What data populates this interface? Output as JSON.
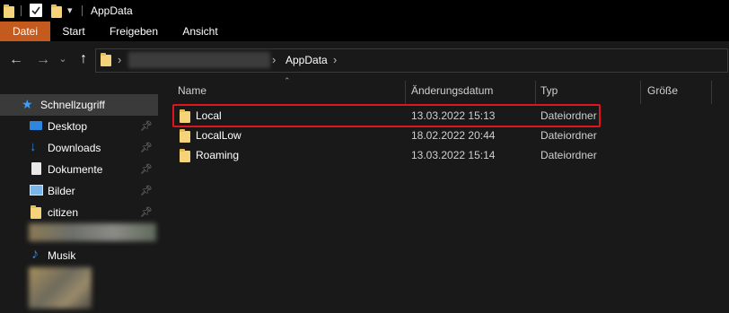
{
  "window": {
    "title": "AppData"
  },
  "ribbon": {
    "tabs": [
      "Datei",
      "Start",
      "Freigeben",
      "Ansicht"
    ]
  },
  "address": {
    "current": "AppData",
    "separator": "›"
  },
  "nav": {
    "back": "←",
    "forward": "→",
    "recent": "⌄",
    "up": "↑"
  },
  "sidebar": {
    "items": [
      {
        "label": "Schnellzugriff",
        "icon": "star-icon"
      },
      {
        "label": "Desktop",
        "icon": "desktop-icon"
      },
      {
        "label": "Downloads",
        "icon": "download-icon"
      },
      {
        "label": "Dokumente",
        "icon": "document-icon"
      },
      {
        "label": "Bilder",
        "icon": "pictures-icon"
      },
      {
        "label": "citizen",
        "icon": "folder-icon"
      },
      {
        "label": "Musik",
        "icon": "music-icon"
      }
    ]
  },
  "columns": {
    "name": "Name",
    "date": "Änderungsdatum",
    "type": "Typ",
    "size": "Größe"
  },
  "files": [
    {
      "name": "Local",
      "date": "13.03.2022 15:13",
      "type": "Dateiordner",
      "size": ""
    },
    {
      "name": "LocalLow",
      "date": "18.02.2022 20:44",
      "type": "Dateiordner",
      "size": ""
    },
    {
      "name": "Roaming",
      "date": "13.03.2022 15:14",
      "type": "Dateiordner",
      "size": ""
    }
  ],
  "colors": {
    "background": "#191919",
    "active_tab": "#c45a1e",
    "highlight_border": "#e0141e",
    "folder": "#f5d37a"
  }
}
